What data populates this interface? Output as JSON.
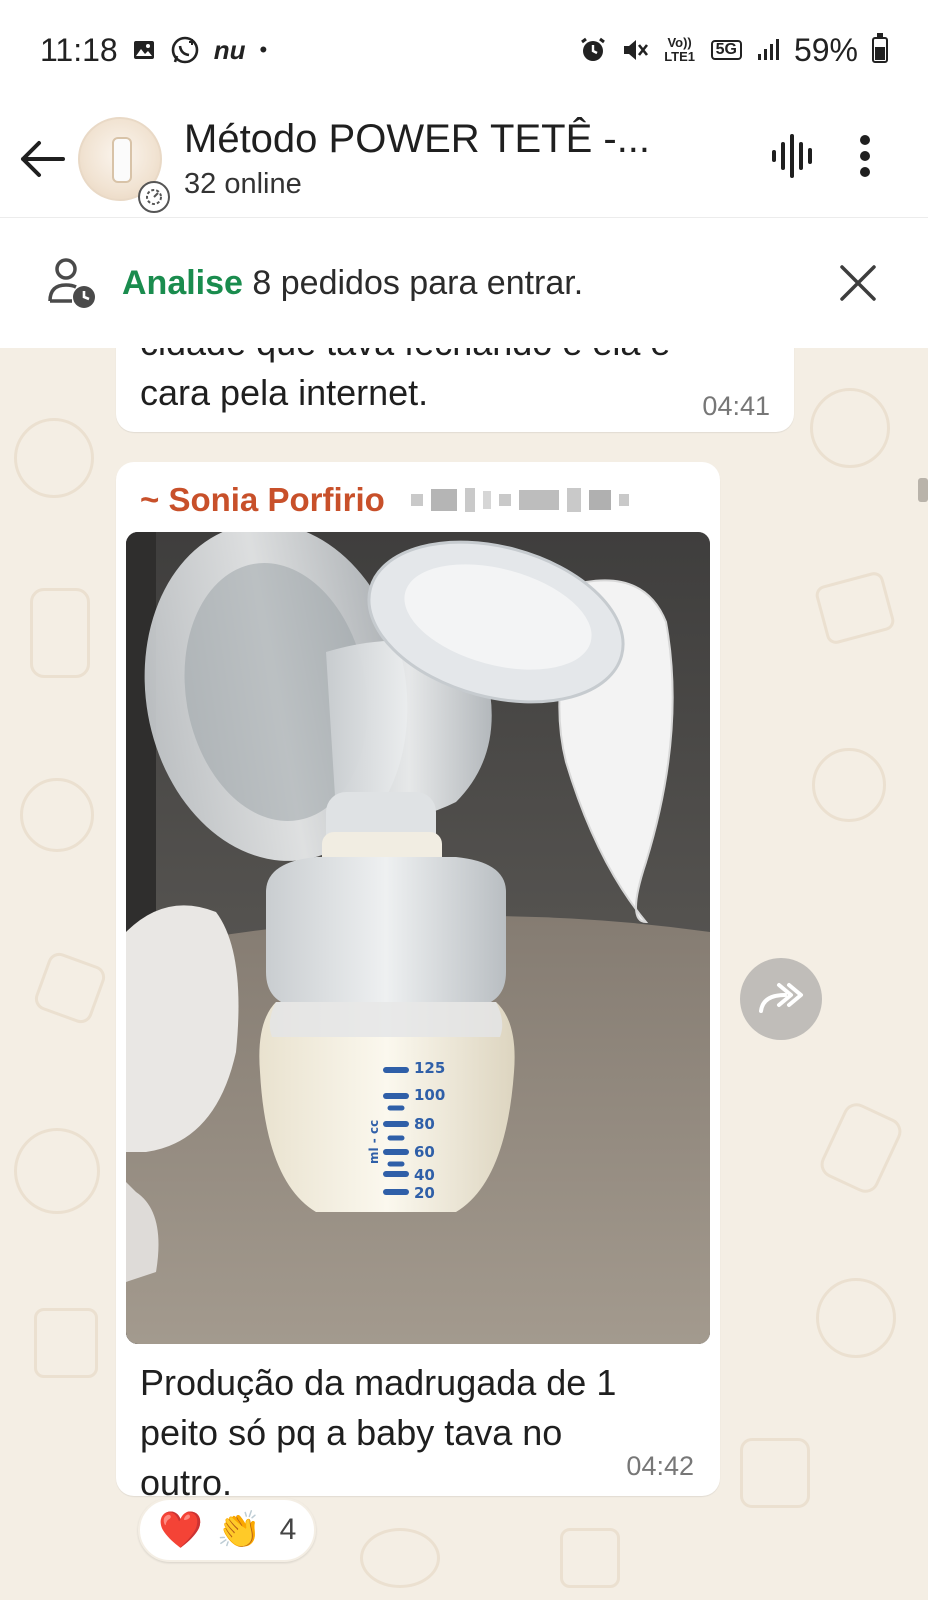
{
  "status_bar": {
    "time": "11:18",
    "app_label": "nu",
    "dot": "•",
    "volte": "Vo)) LTE1",
    "network": "5G",
    "battery": "59%",
    "icons": [
      "image-icon",
      "whatsapp-icon",
      "alarm-icon",
      "mute-icon",
      "signal-icon",
      "battery-icon"
    ]
  },
  "header": {
    "title": "Método POWER TETÊ -...",
    "subtitle": "32 online"
  },
  "banner": {
    "highlight": "Analise",
    "text": " 8 pedidos para entrar."
  },
  "messages": [
    {
      "text": "cidade que tava fechando e ela é cara pela internet.",
      "time": "04:41"
    },
    {
      "sender": "~ Sonia Porfirio",
      "photo_labels": [
        "125",
        "100",
        "80",
        "60",
        "40",
        "20",
        "ml - cc"
      ],
      "text": "Produção da madrugada de 1 peito só pq a baby tava no outro.",
      "time": "04:42",
      "reactions": {
        "emoji_1": "❤️",
        "emoji_2": "👏",
        "count": "4"
      }
    }
  ],
  "colors": {
    "sender": "#c8502a",
    "accent_green": "#1a8c4e",
    "chat_bg": "#f4eee4"
  }
}
